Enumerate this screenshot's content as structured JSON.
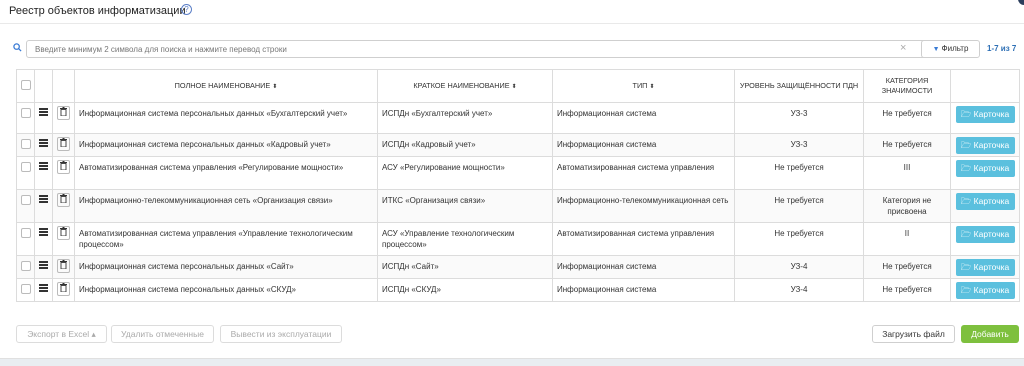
{
  "page": {
    "title": "Реестр объектов информатизации",
    "help_glyph": "?"
  },
  "search": {
    "placeholder": "Введите минимум 2 символа для поиска и нажмите перевод строки",
    "clear_glyph": "×"
  },
  "filter": {
    "label": "Фильтр"
  },
  "pager": {
    "text": "1-7 из 7"
  },
  "table": {
    "headers": {
      "full_name": "Полное наименование",
      "short_name": "Краткое наименование",
      "type": "Тип",
      "protection_level": "Уровень защищённости ПДн",
      "category": "Категория значимости"
    },
    "sort_glyph": "⬍",
    "card_label": "Карточка",
    "rows": [
      {
        "full_name": "Информационная система персональных данных «Бухгалтерский учет»",
        "short_name": "ИСПДн «Бухгалтерский учет»",
        "type": "Информационная система",
        "level": "УЗ-3",
        "category": "Не требуется"
      },
      {
        "full_name": "Информационная система персональных данных «Кадровый учет»",
        "short_name": "ИСПДн «Кадровый учет»",
        "type": "Информационная система",
        "level": "УЗ-3",
        "category": "Не требуется"
      },
      {
        "full_name": "Автоматизированная система управления «Регулирование мощности»",
        "short_name": "АСУ «Регулирование мощности»",
        "type": "Автоматизированная система управления",
        "level": "Не требуется",
        "category": "III"
      },
      {
        "full_name": "Информационно-телекоммуникационная сеть «Организация связи»",
        "short_name": "ИТКС «Организация связи»",
        "type": "Информационно-телекоммуникационная сеть",
        "level": "Не требуется",
        "category": "Категория не присвоена"
      },
      {
        "full_name": "Автоматизированная система управления «Управление технологическим процессом»",
        "short_name": "АСУ «Управление технологическим процессом»",
        "type": "Автоматизированная система управления",
        "level": "Не требуется",
        "category": "II"
      },
      {
        "full_name": "Информационная система персональных данных «Сайт»",
        "short_name": "ИСПДн «Сайт»",
        "type": "Информационная система",
        "level": "УЗ-4",
        "category": "Не требуется"
      },
      {
        "full_name": "Информационная система персональных данных «СКУД»",
        "short_name": "ИСПДн «СКУД»",
        "type": "Информационная система",
        "level": "УЗ-4",
        "category": "Не требуется"
      }
    ]
  },
  "footer": {
    "export_label": "Экспорт в Excel",
    "delete_label": "Удалить отмеченные",
    "decommission_label": "Вывести из эксплуатации",
    "upload_label": "Загрузить файл",
    "add_label": "Добавить"
  },
  "colors": {
    "accent": "#5bc0de",
    "add": "#7ec03e",
    "pager": "#2d6fb5"
  },
  "icons": {
    "help": "help-icon",
    "search": "search-icon",
    "clear": "close-icon",
    "filter": "filter-icon",
    "row_menu": "menu-icon",
    "delete": "trash-icon",
    "card": "folder-icon",
    "export": "caret-up-icon"
  }
}
